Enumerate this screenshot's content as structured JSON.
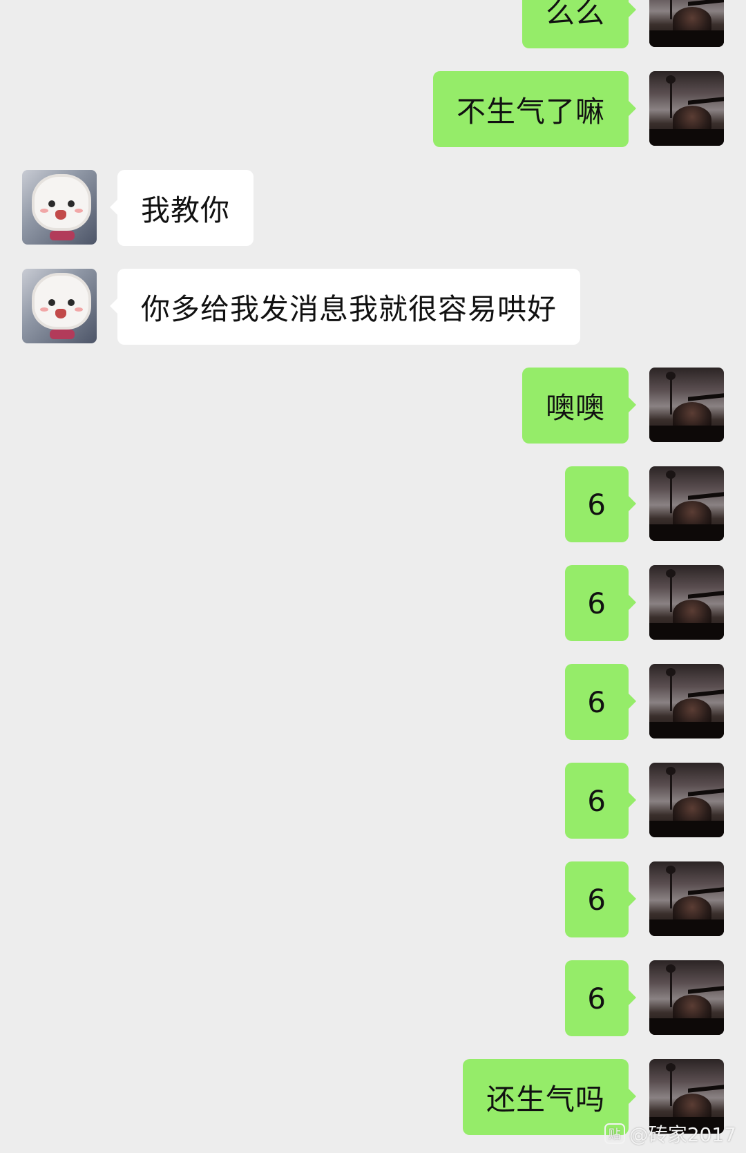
{
  "messages": [
    {
      "side": "out",
      "text": "么么"
    },
    {
      "side": "out",
      "text": "不生气了嘛"
    },
    {
      "side": "in",
      "text": "我教你"
    },
    {
      "side": "in",
      "text": "你多给我发消息我就很容易哄好"
    },
    {
      "side": "out",
      "text": "噢噢"
    },
    {
      "side": "out",
      "text": "6"
    },
    {
      "side": "out",
      "text": "6"
    },
    {
      "side": "out",
      "text": "6"
    },
    {
      "side": "out",
      "text": "6"
    },
    {
      "side": "out",
      "text": "6"
    },
    {
      "side": "out",
      "text": "6"
    },
    {
      "side": "out",
      "text": "还生气吗"
    }
  ],
  "watermark": {
    "icon_glyph": "贴",
    "text": "@砖家2017"
  },
  "colors": {
    "background": "#ededed",
    "outgoing_bubble": "#95ec69",
    "incoming_bubble": "#ffffff"
  },
  "icons": {
    "self_avatar": "dusk-photo-avatar",
    "other_avatar": "cartoon-sheep-avatar"
  }
}
